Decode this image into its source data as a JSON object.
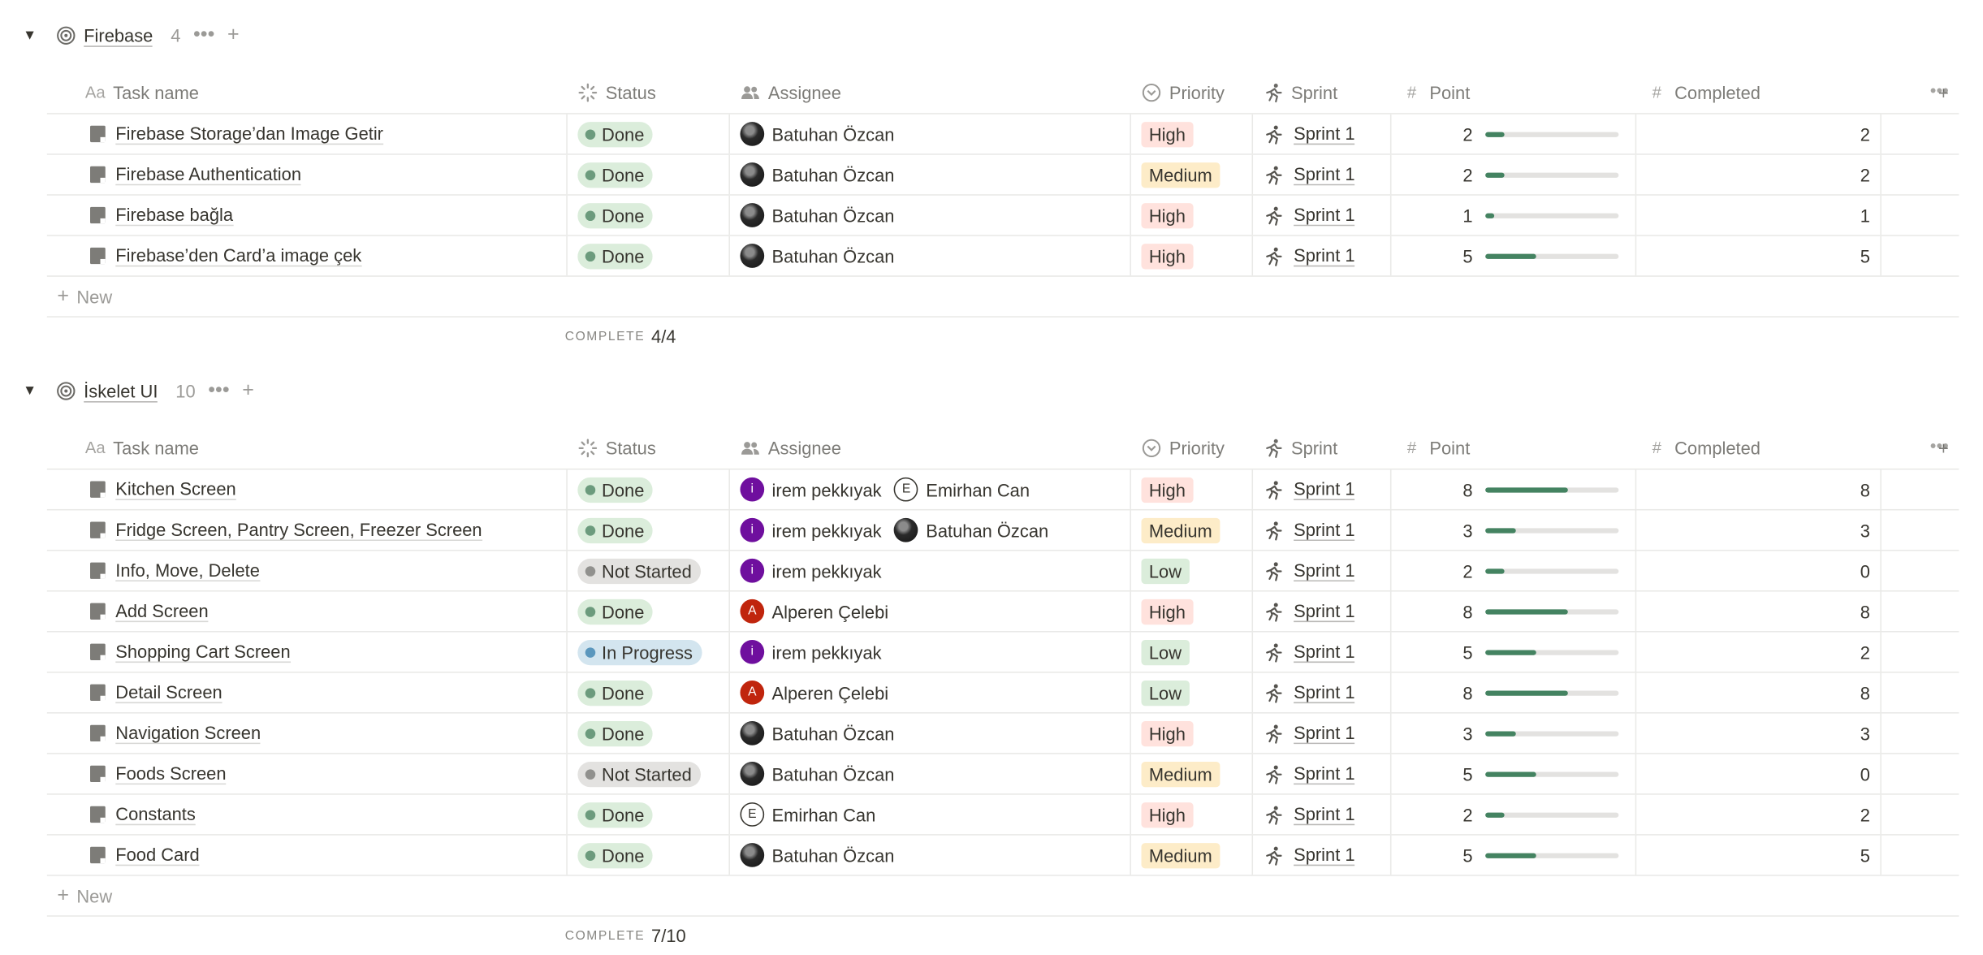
{
  "columns": {
    "task_name": "Task name",
    "status": "Status",
    "assignee": "Assignee",
    "priority": "Priority",
    "sprint": "Sprint",
    "point": "Point",
    "completed": "Completed"
  },
  "icons": {
    "task_name": "text-aa-icon",
    "status": "status-spinner-icon",
    "assignee": "people-icon",
    "priority": "priority-chevron-icon",
    "sprint": "runner-icon",
    "point": "hash-icon",
    "completed": "hash-icon",
    "group": "target-icon",
    "row": "page-icon"
  },
  "colors": {
    "done_bg": "#dbeddb",
    "done_dot": "#6c9b7d",
    "not_started_bg": "#e3e2e0",
    "not_started_dot": "#91918e",
    "in_progress_bg": "#d3e5ef",
    "in_progress_dot": "#5b97bd",
    "high_bg": "#ffe2dd",
    "medium_bg": "#fdecc8",
    "low_bg": "#dbeddb",
    "bar_fill": "#448361",
    "avatar_irem": "#6f0f9e",
    "avatar_alperen": "#c0250d"
  },
  "new_label": "New",
  "complete_label": "COMPLETE",
  "groups": [
    {
      "title": "Firebase",
      "count": "4",
      "complete": "4/4",
      "rows": [
        {
          "name": "Firebase Storage’dan Image Getir",
          "status": "Done",
          "assignees": [
            {
              "name": "Batuhan Özcan",
              "avatar": "photo",
              "initial": ""
            }
          ],
          "priority": "High",
          "sprint": "Sprint 1",
          "point": "2",
          "progress": 0.14,
          "completed": "2"
        },
        {
          "name": "Firebase Authentication",
          "status": "Done",
          "assignees": [
            {
              "name": "Batuhan Özcan",
              "avatar": "photo",
              "initial": ""
            }
          ],
          "priority": "Medium",
          "sprint": "Sprint 1",
          "point": "2",
          "progress": 0.14,
          "completed": "2"
        },
        {
          "name": "Firebase bağla",
          "status": "Done",
          "assignees": [
            {
              "name": "Batuhan Özcan",
              "avatar": "photo",
              "initial": ""
            }
          ],
          "priority": "High",
          "sprint": "Sprint 1",
          "point": "1",
          "progress": 0.07,
          "completed": "1"
        },
        {
          "name": "Firebase’den Card’a image çek",
          "status": "Done",
          "assignees": [
            {
              "name": "Batuhan Özcan",
              "avatar": "photo",
              "initial": ""
            }
          ],
          "priority": "High",
          "sprint": "Sprint 1",
          "point": "5",
          "progress": 0.38,
          "completed": "5"
        }
      ]
    },
    {
      "title": "İskelet UI",
      "count": "10",
      "complete": "7/10",
      "rows": [
        {
          "name": "Kitchen Screen",
          "status": "Done",
          "assignees": [
            {
              "name": "irem pekkıyak",
              "avatar": "irem",
              "initial": "i"
            },
            {
              "name": "Emirhan Can",
              "avatar": "outline",
              "initial": "E"
            }
          ],
          "priority": "High",
          "sprint": "Sprint 1",
          "point": "8",
          "progress": 0.62,
          "completed": "8"
        },
        {
          "name": "Fridge Screen, Pantry Screen, Freezer Screen",
          "status": "Done",
          "assignees": [
            {
              "name": "irem pekkıyak",
              "avatar": "irem",
              "initial": "i"
            },
            {
              "name": "Batuhan Özcan",
              "avatar": "photo",
              "initial": ""
            }
          ],
          "priority": "Medium",
          "sprint": "Sprint 1",
          "point": "3",
          "progress": 0.23,
          "completed": "3"
        },
        {
          "name": "Info, Move, Delete",
          "status": "Not Started",
          "assignees": [
            {
              "name": "irem pekkıyak",
              "avatar": "irem",
              "initial": "i"
            }
          ],
          "priority": "Low",
          "sprint": "Sprint 1",
          "point": "2",
          "progress": 0.14,
          "completed": "0"
        },
        {
          "name": "Add Screen",
          "status": "Done",
          "assignees": [
            {
              "name": "Alperen Çelebi",
              "avatar": "alperen",
              "initial": "A"
            }
          ],
          "priority": "High",
          "sprint": "Sprint 1",
          "point": "8",
          "progress": 0.62,
          "completed": "8"
        },
        {
          "name": "Shopping Cart Screen",
          "status": "In Progress",
          "assignees": [
            {
              "name": "irem pekkıyak",
              "avatar": "irem",
              "initial": "i"
            }
          ],
          "priority": "Low",
          "sprint": "Sprint 1",
          "point": "5",
          "progress": 0.38,
          "completed": "2"
        },
        {
          "name": "Detail Screen",
          "status": "Done",
          "assignees": [
            {
              "name": "Alperen Çelebi",
              "avatar": "alperen",
              "initial": "A"
            }
          ],
          "priority": "Low",
          "sprint": "Sprint 1",
          "point": "8",
          "progress": 0.62,
          "completed": "8"
        },
        {
          "name": "Navigation Screen",
          "status": "Done",
          "assignees": [
            {
              "name": "Batuhan Özcan",
              "avatar": "photo",
              "initial": ""
            }
          ],
          "priority": "High",
          "sprint": "Sprint 1",
          "point": "3",
          "progress": 0.23,
          "completed": "3"
        },
        {
          "name": "Foods Screen",
          "status": "Not Started",
          "assignees": [
            {
              "name": "Batuhan Özcan",
              "avatar": "photo",
              "initial": ""
            }
          ],
          "priority": "Medium",
          "sprint": "Sprint 1",
          "point": "5",
          "progress": 0.38,
          "completed": "0"
        },
        {
          "name": "Constants",
          "status": "Done",
          "assignees": [
            {
              "name": "Emirhan Can",
              "avatar": "outline",
              "initial": "E"
            }
          ],
          "priority": "High",
          "sprint": "Sprint 1",
          "point": "2",
          "progress": 0.14,
          "completed": "2"
        },
        {
          "name": "Food Card",
          "status": "Done",
          "assignees": [
            {
              "name": "Batuhan Özcan",
              "avatar": "photo",
              "initial": ""
            }
          ],
          "priority": "Medium",
          "sprint": "Sprint 1",
          "point": "5",
          "progress": 0.38,
          "completed": "5"
        }
      ]
    }
  ]
}
